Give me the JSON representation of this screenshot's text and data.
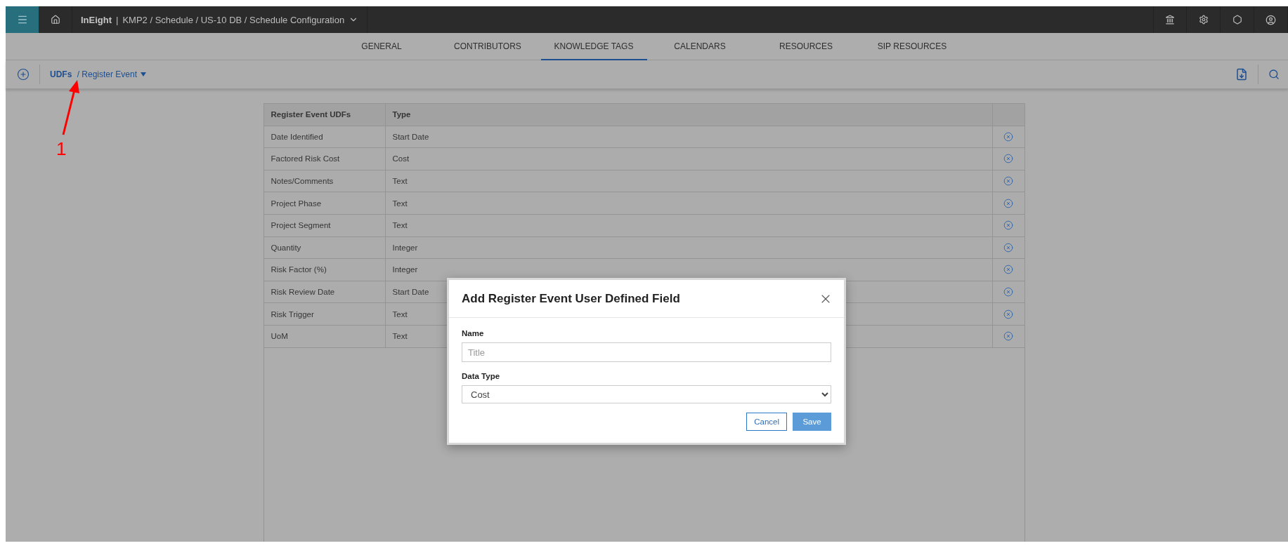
{
  "top_bar": {
    "brand": "InEight",
    "divider": "|",
    "breadcrumb": "KMP2 / Schedule / US-10 DB / Schedule Configuration"
  },
  "tabs": [
    {
      "label": "GENERAL",
      "selected": false
    },
    {
      "label": "CONTRIBUTORS",
      "selected": false
    },
    {
      "label": "KNOWLEDGE TAGS",
      "selected": true
    },
    {
      "label": "CALENDARS",
      "selected": false
    },
    {
      "label": "RESOURCES",
      "selected": false
    },
    {
      "label": "SIP RESOURCES",
      "selected": false
    }
  ],
  "toolbar": {
    "breadcrumb": "**UDFs** / Register Event"
  },
  "annotation": {
    "label": "1"
  },
  "table": {
    "columns": [
      "Register Event UDFs",
      "Type"
    ],
    "rows": [
      {
        "name": "Date Identified",
        "type": "Start Date"
      },
      {
        "name": "Factored Risk Cost",
        "type": "Cost"
      },
      {
        "name": "Notes/Comments",
        "type": "Text"
      },
      {
        "name": "Project Phase",
        "type": "Text"
      },
      {
        "name": "Project Segment",
        "type": "Text"
      },
      {
        "name": "Quantity",
        "type": "Integer"
      },
      {
        "name": "Risk Factor (%)",
        "type": "Integer"
      },
      {
        "name": "Risk Review Date",
        "type": "Start Date"
      },
      {
        "name": "Risk Trigger",
        "type": "Text"
      },
      {
        "name": "UoM",
        "type": "Text"
      }
    ]
  },
  "dialog": {
    "title": "Add Register Event User Defined Field",
    "name_field": {
      "label": "Name",
      "placeholder": "Title"
    },
    "type_field": {
      "label": "Data Type",
      "value": "Cost"
    },
    "buttons": [
      {
        "label": "Cancel",
        "kind": "secondary"
      },
      {
        "label": "Save",
        "kind": "primary"
      }
    ]
  }
}
